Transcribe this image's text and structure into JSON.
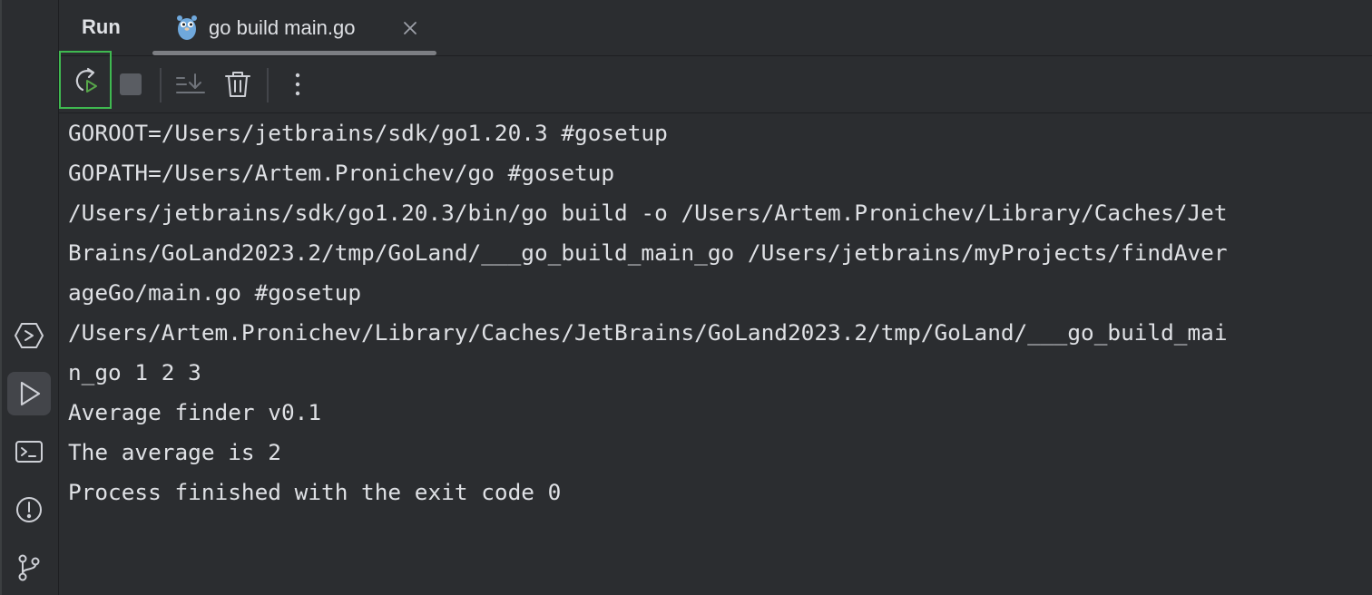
{
  "header": {
    "title": "Run"
  },
  "tab": {
    "label": "go build main.go",
    "icon": "gopher-icon",
    "close_icon": "close-icon"
  },
  "toolbar": {
    "rerun_icon": "rerun-icon",
    "stop_icon": "stop-icon",
    "scroll_icon": "scroll-to-end-icon",
    "clear_icon": "trash-icon",
    "more_icon": "more-vertical-icon"
  },
  "side_toolbar": [
    "services-icon",
    "run-icon",
    "terminal-icon",
    "problems-icon",
    "git-icon"
  ],
  "console": {
    "lines": [
      "GOROOT=/Users/jetbrains/sdk/go1.20.3 #gosetup",
      "GOPATH=/Users/Artem.Pronichev/go #gosetup",
      "/Users/jetbrains/sdk/go1.20.3/bin/go build -o /Users/Artem.Pronichev/Library/Caches/Jet",
      "Brains/GoLand2023.2/tmp/GoLand/___go_build_main_go /Users/jetbrains/myProjects/findAver",
      "ageGo/main.go #gosetup",
      "/Users/Artem.Pronichev/Library/Caches/JetBrains/GoLand2023.2/tmp/GoLand/___go_build_mai",
      "n_go 1 2 3",
      "Average finder v0.1",
      "The average is 2",
      "Process finished with the exit code 0"
    ]
  },
  "colors": {
    "background": "#2b2d30",
    "text": "#dfe1e5",
    "highlight_border": "#3fb950",
    "run_green": "#57a64a"
  }
}
